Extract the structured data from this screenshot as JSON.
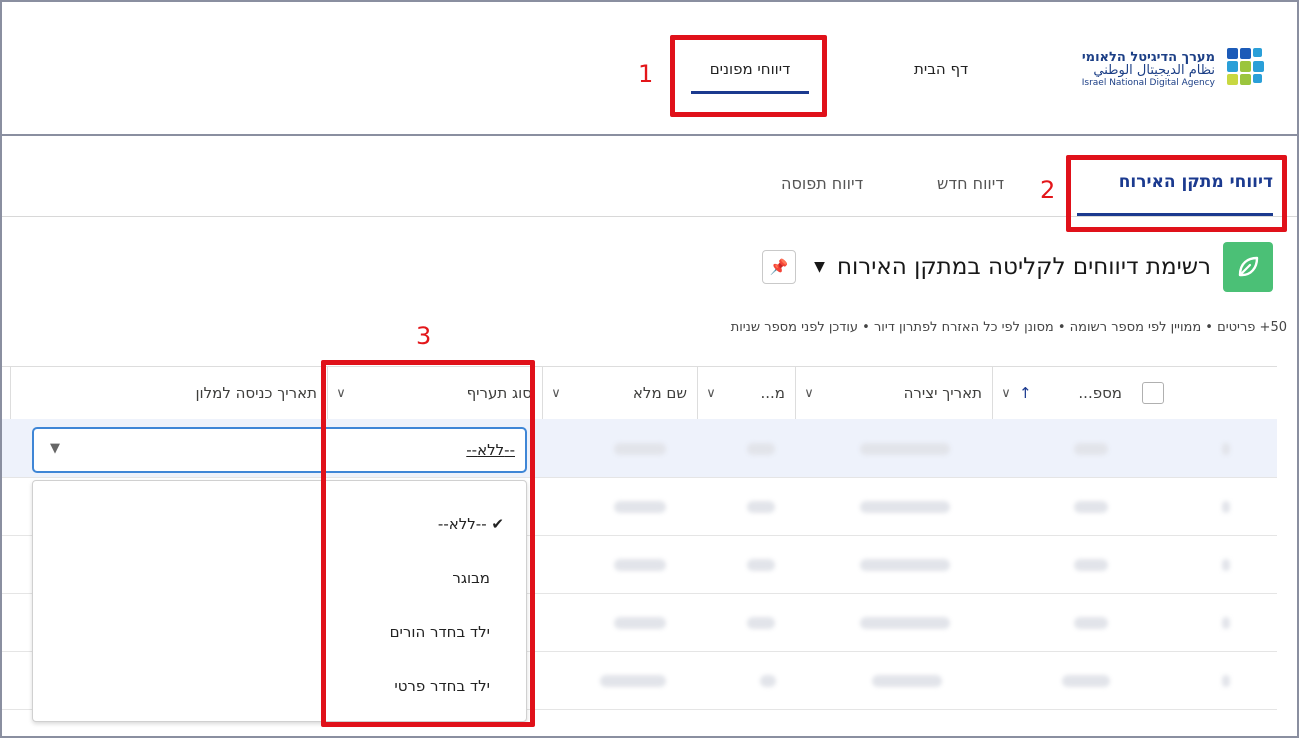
{
  "brand": {
    "name_he_line1": "מערך הדיגיטל הלאומי",
    "name_ar": "نظام الديجيتال الوطني",
    "name_en": "Israel National Digital Agency"
  },
  "top_nav": {
    "items": [
      {
        "label": "דף הבית"
      },
      {
        "label": "דיווחי מפונים"
      }
    ]
  },
  "annotations": [
    "1",
    "2",
    "3"
  ],
  "tabs": [
    {
      "label": "דיווחי מתקן האירוח"
    },
    {
      "label": "דיווח חדש"
    },
    {
      "label": "דיווח תפוסה"
    }
  ],
  "list_view": {
    "title": "רשימת דיווחים לקליטה במתקן האירוח",
    "meta": "50+ פריטים • ממויין לפי מספר רשומה • מסונן לפי כל האזרח לפתרון דיור • עודכן לפני מספר שניות"
  },
  "table": {
    "columns": [
      {
        "label": "מספ..."
      },
      {
        "label": "תאריך יצירה"
      },
      {
        "label": "מ..."
      },
      {
        "label": "שם מלא"
      },
      {
        "label": "סוג תעריף"
      },
      {
        "label": "תאריך כניסה למלון"
      }
    ]
  },
  "picklist": {
    "value": "--ללא--",
    "options": [
      {
        "label": "--ללא--",
        "selected": true
      },
      {
        "label": "מבוגר"
      },
      {
        "label": "ילד בחדר הורים"
      },
      {
        "label": "ילד בחדר פרטי"
      }
    ]
  },
  "colors": {
    "accent": "#1b3a8f",
    "annotation": "#e0111a",
    "focus": "#3f86d6",
    "icon_green": "#4bc076"
  }
}
